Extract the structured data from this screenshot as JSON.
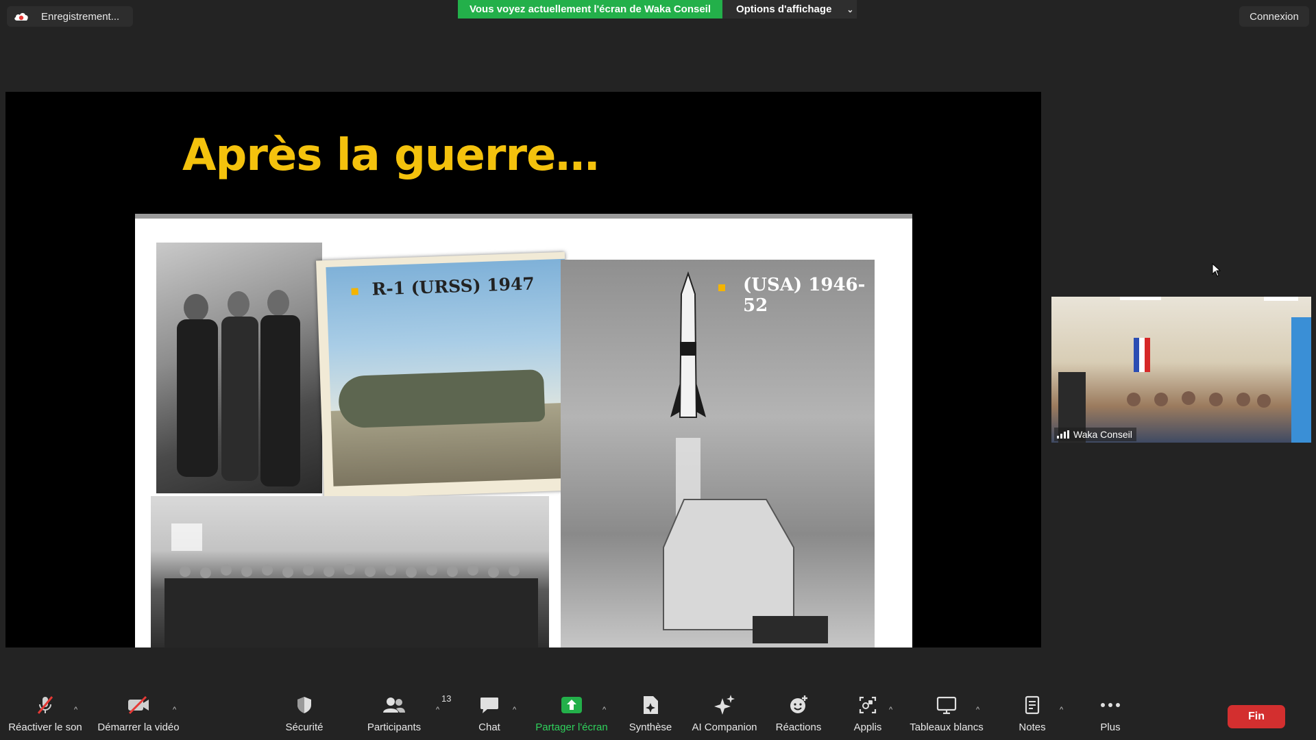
{
  "topbar": {
    "recording_label": "Enregistrement...",
    "share_banner": "Vous voyez actuellement l'écran de Waka Conseil",
    "view_options": "Options d'affichage",
    "connexion": "Connexion"
  },
  "slide": {
    "title": "Après la guerre…",
    "photo_r1_caption": "R-1 (URSS) 1947",
    "photo_usa_caption": "(USA) 1946-52",
    "accent_color": "#f4c20d"
  },
  "video": {
    "participant_name": "Waka Conseil"
  },
  "toolbar": {
    "unmute": "Réactiver le son",
    "start_video": "Démarrer la vidéo",
    "security": "Sécurité",
    "participants": "Participants",
    "participants_count": "13",
    "chat": "Chat",
    "share_screen": "Partager l'écran",
    "summary": "Synthèse",
    "ai_companion": "AI Companion",
    "reactions": "Réactions",
    "apps": "Applis",
    "whiteboards": "Tableaux blancs",
    "notes": "Notes",
    "more": "Plus",
    "end": "Fin"
  }
}
